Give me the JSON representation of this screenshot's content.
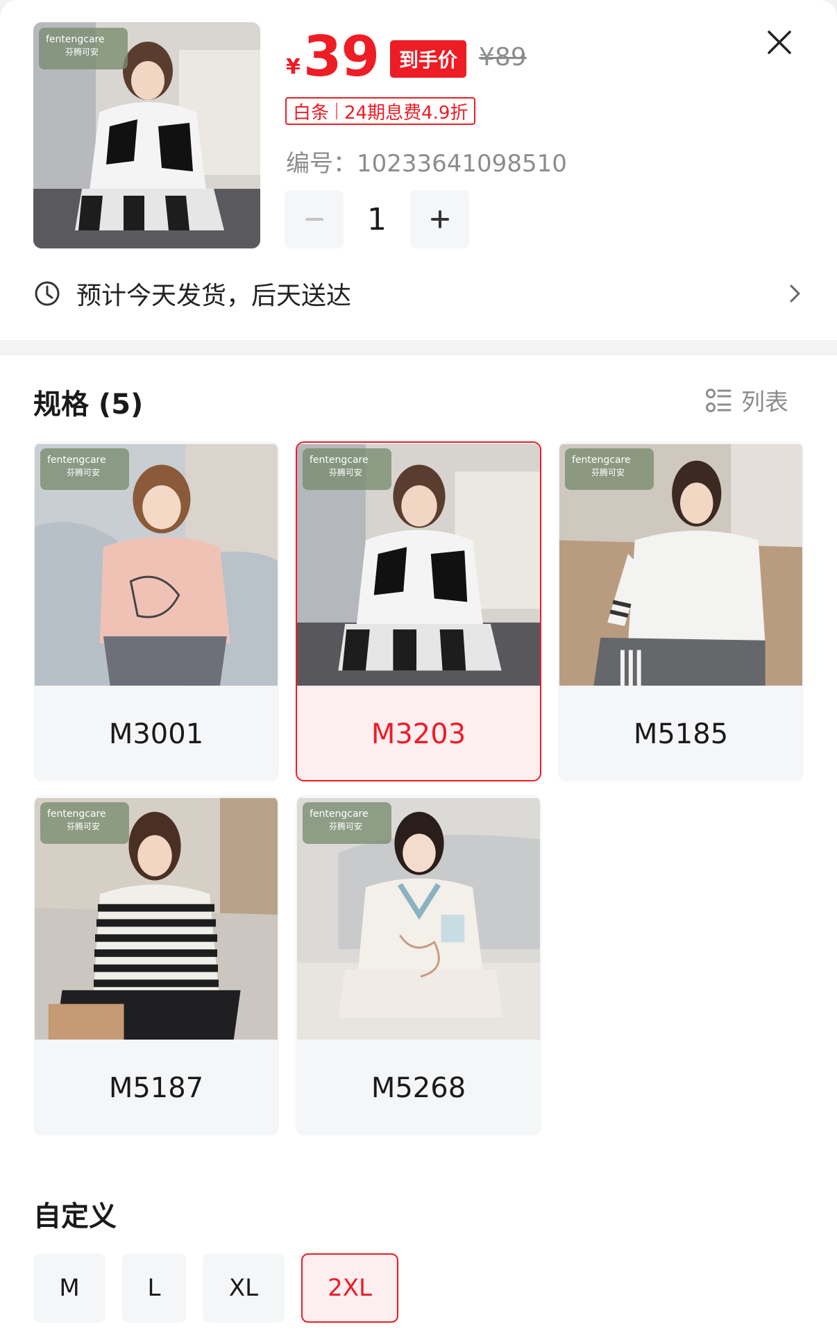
{
  "header": {
    "currency": "¥",
    "price": "39",
    "price_badge": "到手价",
    "original_price": "¥89",
    "installment": {
      "label": "白条",
      "detail": "24期息费4.9折"
    },
    "sku_number": "编号：10233641098510",
    "quantity": "1",
    "close_icon": "close-icon",
    "brand_tag": "fentengcare",
    "brand_sub": "芬腾可安"
  },
  "delivery": {
    "icon": "clock-icon",
    "text": "预计今天发货，后天送达"
  },
  "specs": {
    "title": "规格 (5)",
    "view_toggle": "列表",
    "selected": "M3203",
    "items": [
      {
        "label": "M3001"
      },
      {
        "label": "M3203"
      },
      {
        "label": "M5185"
      },
      {
        "label": "M5187"
      },
      {
        "label": "M5268"
      }
    ]
  },
  "custom": {
    "title": "自定义",
    "selected": "2XL",
    "sizes": [
      "M",
      "L",
      "XL",
      "2XL"
    ]
  },
  "colors": {
    "accent": "#ee1c25",
    "selected_bg": "#fdeef0",
    "chip_bg": "#f5f6f8",
    "muted_text": "#8c8c8c"
  }
}
